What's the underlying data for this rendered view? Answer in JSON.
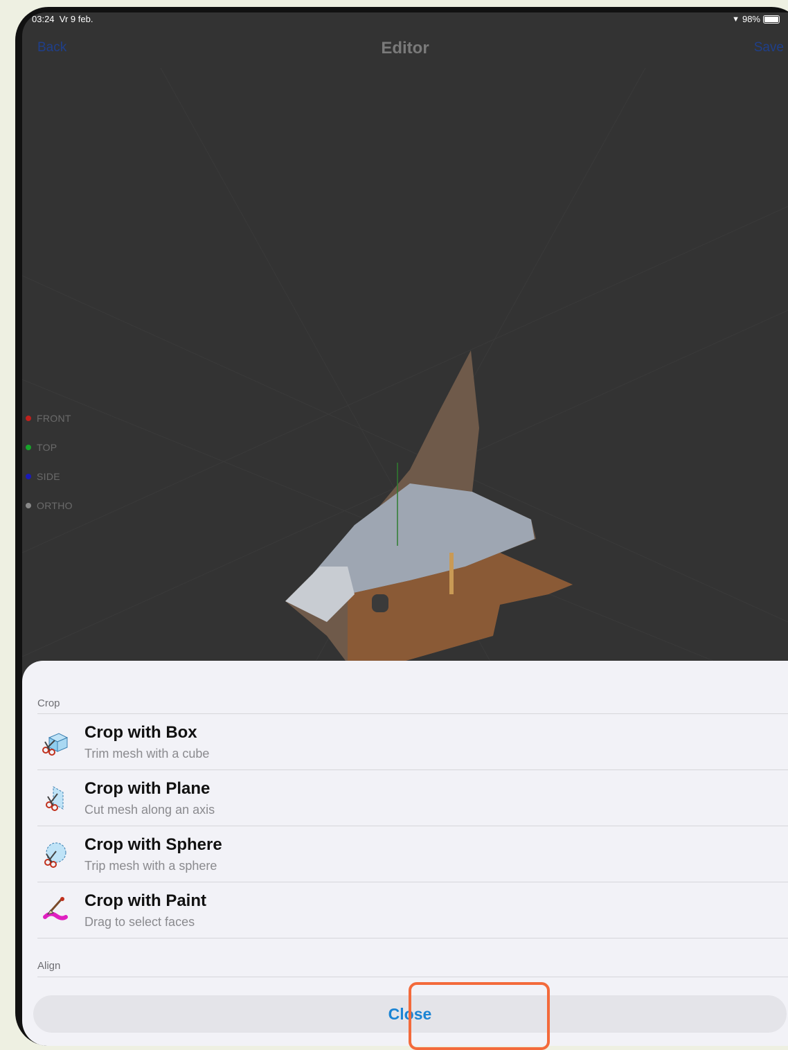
{
  "status_bar": {
    "time": "03:24",
    "date": "Vr 9 feb.",
    "battery": "98%"
  },
  "navbar": {
    "back_label": "Back",
    "title": "Editor",
    "save_label": "Save"
  },
  "view_modes": [
    {
      "label": "FRONT",
      "color": "#c0201c"
    },
    {
      "label": "TOP",
      "color": "#17a32a"
    },
    {
      "label": "SIDE",
      "color": "#1a1ab8"
    },
    {
      "label": "ORTHO",
      "color": "#8a8a8a"
    }
  ],
  "sheet": {
    "crop_header": "Crop",
    "items": [
      {
        "title": "Crop with Box",
        "subtitle": "Trim mesh with a cube",
        "icon": "crop-box-icon"
      },
      {
        "title": "Crop with Plane",
        "subtitle": "Cut mesh along an axis",
        "icon": "crop-plane-icon"
      },
      {
        "title": "Crop with Sphere",
        "subtitle": "Trip mesh with a sphere",
        "icon": "crop-sphere-icon"
      },
      {
        "title": "Crop with Paint",
        "subtitle": "Drag to select faces",
        "icon": "crop-paint-icon"
      }
    ],
    "align_header": "Align",
    "close_label": "Close"
  },
  "colors": {
    "accent": "#1b84d4",
    "highlight": "#f36a3b",
    "canvas": "#333333",
    "sheet": "#f2f2f7"
  }
}
